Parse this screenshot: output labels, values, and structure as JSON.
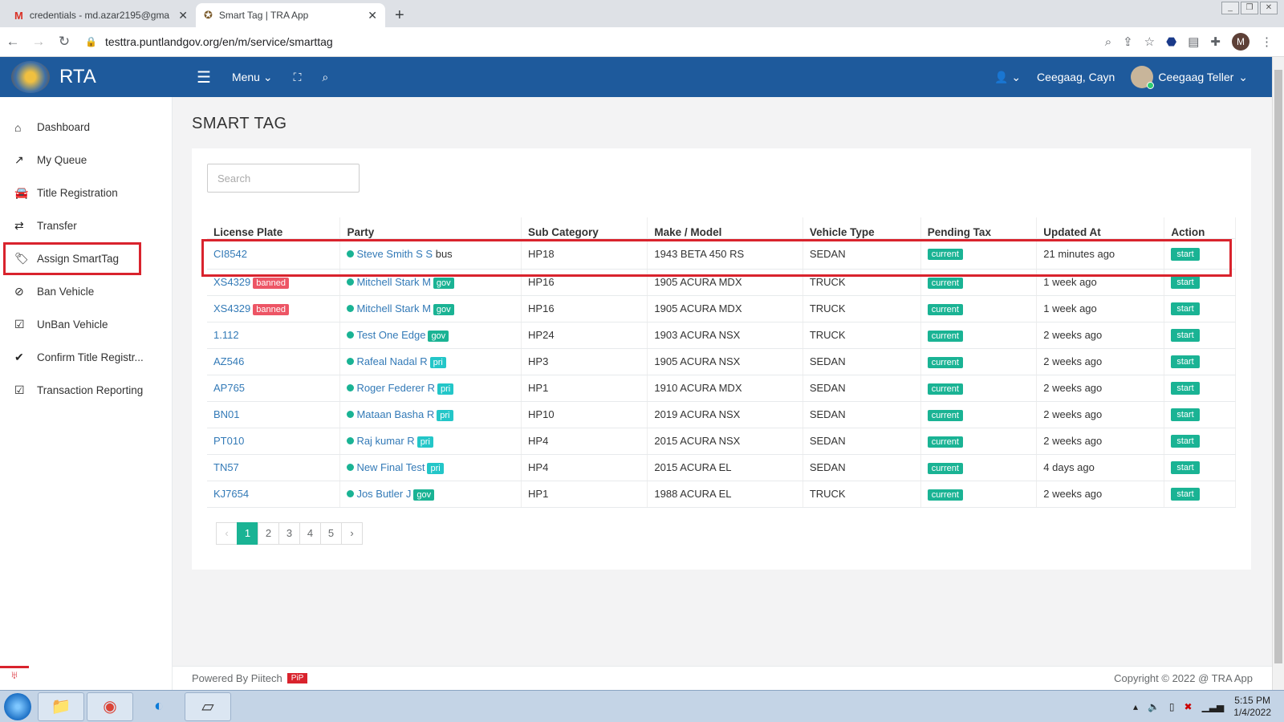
{
  "browser": {
    "tabs": [
      {
        "title": "credentials - md.azar2195@gma",
        "icon": "gmail-icon",
        "active": false
      },
      {
        "title": "Smart Tag | TRA App",
        "icon": "seal-icon",
        "active": true
      }
    ],
    "url": "testtra.puntlandgov.org/en/m/service/smarttag",
    "profile_initial": "M"
  },
  "header": {
    "brand": "RTA",
    "menu_label": "Menu",
    "location": "Ceegaag, Cayn",
    "user": "Ceegaag Teller"
  },
  "sidebar": {
    "items": [
      {
        "label": "Dashboard",
        "icon": "home-icon"
      },
      {
        "label": "My Queue",
        "icon": "trend-icon"
      },
      {
        "label": "Title Registration",
        "icon": "car-icon"
      },
      {
        "label": "Transfer",
        "icon": "transfer-icon"
      },
      {
        "label": "Assign SmartTag",
        "icon": "tags-icon",
        "highlighted": true
      },
      {
        "label": "Ban Vehicle",
        "icon": "ban-icon"
      },
      {
        "label": "UnBan Vehicle",
        "icon": "check-square-icon"
      },
      {
        "label": "Confirm Title Registr...",
        "icon": "check-icon"
      },
      {
        "label": "Transaction Reporting",
        "icon": "check-square-icon"
      }
    ]
  },
  "page": {
    "title": "SMART TAG",
    "search_placeholder": "Search"
  },
  "table": {
    "columns": [
      "License Plate",
      "Party",
      "Sub Category",
      "Make / Model",
      "Vehicle Type",
      "Pending Tax",
      "Updated At",
      "Action"
    ],
    "rows": [
      {
        "plate": "CI8542",
        "plate_tag": "",
        "party": "Steve Smith S S",
        "party_tag": "bus",
        "sub": "HP18",
        "model": "1943 BETA 450 RS",
        "type": "SEDAN",
        "tax": "current",
        "updated": "21 minutes ago",
        "action": "start"
      },
      {
        "plate": "XS4329",
        "plate_tag": "banned",
        "party": "Mitchell Stark M",
        "party_tag": "gov",
        "sub": "HP16",
        "model": "1905 ACURA MDX",
        "type": "TRUCK",
        "tax": "current",
        "updated": "1 week ago",
        "action": "start"
      },
      {
        "plate": "XS4329",
        "plate_tag": "banned",
        "party": "Mitchell Stark M",
        "party_tag": "gov",
        "sub": "HP16",
        "model": "1905 ACURA MDX",
        "type": "TRUCK",
        "tax": "current",
        "updated": "1 week ago",
        "action": "start"
      },
      {
        "plate": "1.112",
        "plate_tag": "",
        "party": "Test One Edge",
        "party_tag": "gov",
        "sub": "HP24",
        "model": "1903 ACURA NSX",
        "type": "TRUCK",
        "tax": "current",
        "updated": "2 weeks ago",
        "action": "start"
      },
      {
        "plate": "AZ546",
        "plate_tag": "",
        "party": "Rafeal Nadal R",
        "party_tag": "pri",
        "sub": "HP3",
        "model": "1905 ACURA NSX",
        "type": "SEDAN",
        "tax": "current",
        "updated": "2 weeks ago",
        "action": "start"
      },
      {
        "plate": "AP765",
        "plate_tag": "",
        "party": "Roger Federer R",
        "party_tag": "pri",
        "sub": "HP1",
        "model": "1910 ACURA MDX",
        "type": "SEDAN",
        "tax": "current",
        "updated": "2 weeks ago",
        "action": "start"
      },
      {
        "plate": "BN01",
        "plate_tag": "",
        "party": "Mataan Basha R",
        "party_tag": "pri",
        "sub": "HP10",
        "model": "2019 ACURA NSX",
        "type": "SEDAN",
        "tax": "current",
        "updated": "2 weeks ago",
        "action": "start"
      },
      {
        "plate": "PT010",
        "plate_tag": "",
        "party": "Raj kumar R",
        "party_tag": "pri",
        "sub": "HP4",
        "model": "2015 ACURA NSX",
        "type": "SEDAN",
        "tax": "current",
        "updated": "2 weeks ago",
        "action": "start"
      },
      {
        "plate": "TN57",
        "plate_tag": "",
        "party": "New Final Test",
        "party_tag": "pri",
        "sub": "HP4",
        "model": "2015 ACURA EL",
        "type": "SEDAN",
        "tax": "current",
        "updated": "4 days ago",
        "action": "start"
      },
      {
        "plate": "KJ7654",
        "plate_tag": "",
        "party": "Jos Butler J",
        "party_tag": "gov",
        "sub": "HP1",
        "model": "1988 ACURA EL",
        "type": "TRUCK",
        "tax": "current",
        "updated": "2 weeks ago",
        "action": "start"
      }
    ]
  },
  "pagination": {
    "prev": "‹",
    "pages": [
      "1",
      "2",
      "3",
      "4",
      "5"
    ],
    "current": "1",
    "next": "›"
  },
  "footer": {
    "powered": "Powered By Piitech",
    "badge": "PiP",
    "copyright": "Copyright © 2022 @ TRA App"
  },
  "taskbar": {
    "time": "5:15 PM",
    "date": "1/4/2022"
  },
  "colors": {
    "header": "#1e5a9c",
    "accent": "#1ab394",
    "danger": "#ed5565",
    "highlight": "#d9232d"
  }
}
